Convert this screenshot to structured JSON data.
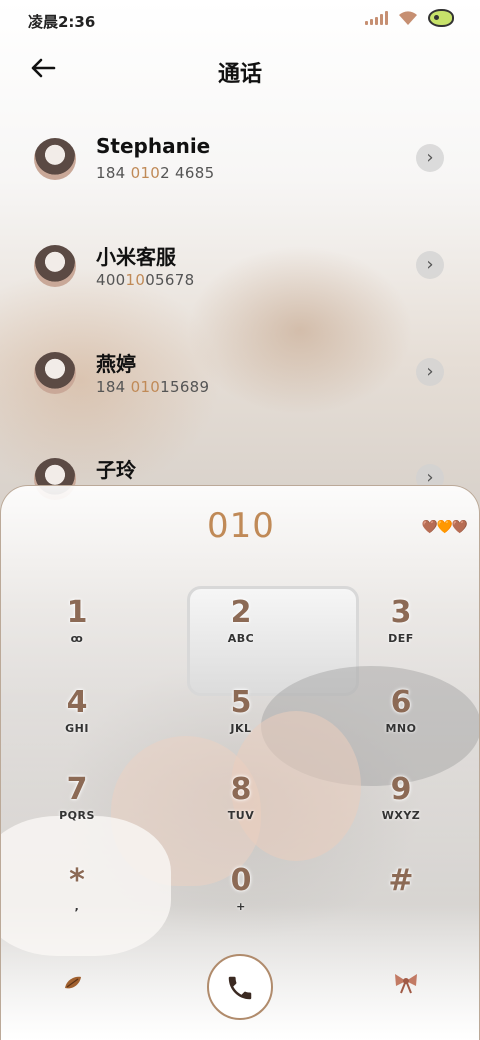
{
  "status": {
    "time": "凌晨2:36"
  },
  "header": {
    "title": "通话",
    "back_icon": "arrow-left-icon"
  },
  "contacts": [
    {
      "name": "Stephanie",
      "num_pre": "184 ",
      "num_hl": "010",
      "num_post": "2 4685"
    },
    {
      "name": "小米客服",
      "num_pre": "400",
      "num_hl": "10",
      "num_post": "05678"
    },
    {
      "name": "燕婷",
      "num_pre": "184 ",
      "num_hl": "010",
      "num_post": "15689"
    },
    {
      "name": "子玲",
      "num_pre": "",
      "num_hl": "",
      "num_post": ""
    }
  ],
  "dialer": {
    "dialed": "010",
    "hearts": "🤎🧡🤎",
    "keys": [
      {
        "d": "1",
        "l": "ꝏ"
      },
      {
        "d": "2",
        "l": "ABC"
      },
      {
        "d": "3",
        "l": "DEF"
      },
      {
        "d": "4",
        "l": "GHI"
      },
      {
        "d": "5",
        "l": "JKL"
      },
      {
        "d": "6",
        "l": "MNO"
      },
      {
        "d": "7",
        "l": "PQRS"
      },
      {
        "d": "8",
        "l": "TUV"
      },
      {
        "d": "9",
        "l": "WXYZ"
      },
      {
        "d": "*",
        "l": ","
      },
      {
        "d": "0",
        "l": "+"
      },
      {
        "d": "#",
        "l": ""
      }
    ]
  },
  "colors": {
    "accent": "#c08a57",
    "digit": "#8c6a55"
  }
}
